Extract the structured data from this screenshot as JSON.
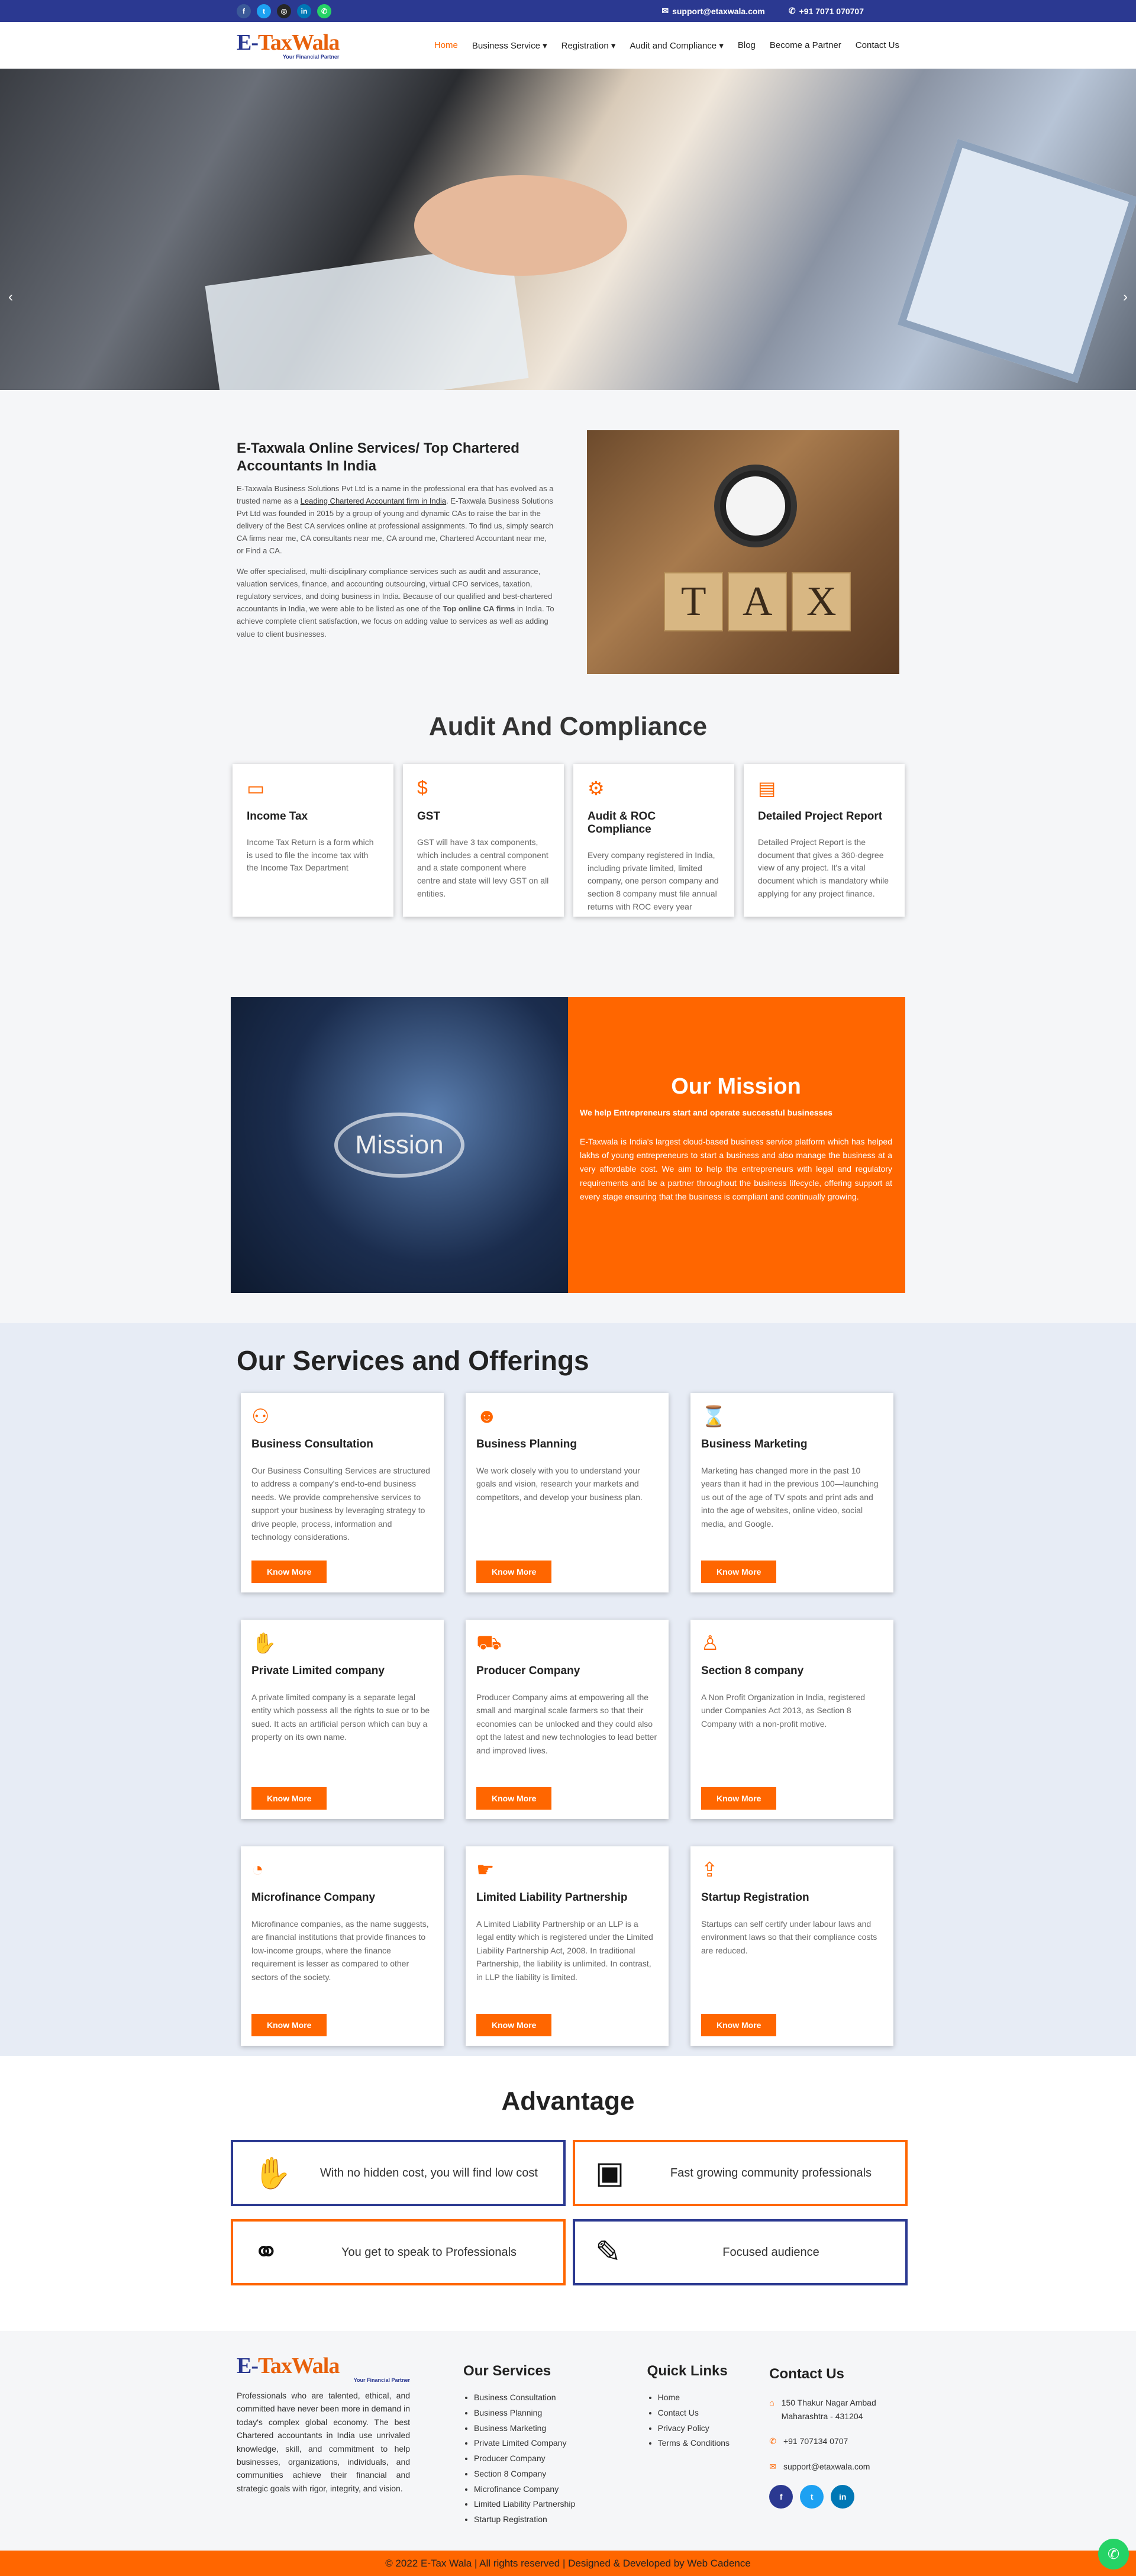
{
  "topbar": {
    "email": "support@etaxwala.com",
    "phone": "+91 7071 070707",
    "socials": [
      "facebook-icon",
      "twitter-icon",
      "instagram-icon",
      "linkedin-icon",
      "whatsapp-icon"
    ]
  },
  "logo": {
    "main_a": "E-",
    "main_b": "TaxWala",
    "sub": "Your Financial Partner"
  },
  "nav": [
    "Home",
    "Business Service",
    "Registration",
    "Audit and Compliance",
    "Blog",
    "Become a Partner",
    "Contact Us"
  ],
  "about": {
    "title": "E-Taxwala Online Services/ Top Chartered Accountants In India",
    "p1a": "E-Taxwala Business Solutions Pvt Ltd is a name in the professional era that has evolved as a trusted name as a ",
    "p1link": "Leading Chartered Accountant firm in India",
    "p1b": ". E-Taxwala Business Solutions Pvt Ltd was founded in 2015 by a group of young and dynamic CAs to raise the bar in the delivery of the Best CA services online at professional assignments. To find us, simply search CA firms near me, CA consultants near me, CA around me, Chartered Accountant near me, or Find a CA.",
    "p2a": "We offer specialised, multi-disciplinary compliance services such as audit and assurance, valuation services, finance, and accounting outsourcing, virtual CFO services, taxation, regulatory services, and doing business in India. Because of our qualified and best-chartered accountants in India, we were able to be listed as one of the ",
    "p2bold": "Top online CA firms",
    "p2b": " in India. To achieve complete client satisfaction, we focus on adding value to services as well as adding value to client businesses.",
    "img_letters": [
      "T",
      "A",
      "X"
    ]
  },
  "audit": {
    "title": "Audit And Compliance",
    "cards": [
      {
        "icon": "money-icon",
        "title": "Income Tax",
        "text": "Income Tax Return is a form which is used to file the income tax with the Income Tax Department"
      },
      {
        "icon": "dollar-icon",
        "title": "GST",
        "text": "GST will have 3 tax components, which includes a central component and a state component where centre and state will levy GST on all entities."
      },
      {
        "icon": "users-gear-icon",
        "title": "Audit & ROC Compliance",
        "text": "Every company registered in India, including private limited, limited company, one person company and section 8 company must file annual returns with ROC every year"
      },
      {
        "icon": "document-icon",
        "title": "Detailed Project Report",
        "text": "Detailed Project Report is the document that gives a 360-degree view of any project. It's a vital document which is mandatory while applying for any project finance."
      }
    ]
  },
  "mission": {
    "img_word": "Mission",
    "title": "Our Mission",
    "subtitle": "We help Entrepreneurs start and operate successful businesses",
    "text": "E-Taxwala is India's largest cloud-based business service platform which has helped lakhs of young entrepreneurs to start a business and also manage the business at a very affordable cost. We aim to help the entrepreneurs with legal and regulatory requirements and be a partner throughout the business lifecycle, offering support at every stage ensuring that the business is compliant and continually growing."
  },
  "services": {
    "title": "Our Services and Offerings",
    "button": "Know More",
    "items": [
      {
        "icon": "handshake-people-icon",
        "title": "Business Consultation",
        "text": "Our Business Consulting Services are structured to address a company's end-to-end business needs. We provide comprehensive services to support your business by leveraging strategy to drive people, process, information and technology considerations."
      },
      {
        "icon": "users-icon",
        "title": "Business Planning",
        "text": "We work closely with you to understand your goals and vision, research your markets and competitors, and develop your business plan."
      },
      {
        "icon": "briefcase-clock-icon",
        "title": "Business Marketing",
        "text": "Marketing has changed more in the past 10 years than it had in the previous 100—launching us out of the age of TV spots and print ads and into the age of websites, online video, social media, and Google."
      },
      {
        "icon": "hands-icon",
        "title": "Private Limited company",
        "text": "A private limited company is a separate legal entity which possess all the rights to sue or to be sued. It acts an artificial person which can buy a property on its own name."
      },
      {
        "icon": "tractor-icon",
        "title": "Producer Company",
        "text": "Producer Company aims at empowering all the small and marginal scale farmers so that their economies can be unlocked and they could also opt the latest and new technologies to lead better and improved lives."
      },
      {
        "icon": "person-icon",
        "title": "Section 8 company",
        "text": "A Non Profit Organization in India, registered under Companies Act 2013, as Section 8 Company with a non-profit motive."
      },
      {
        "icon": "user-clock-icon",
        "title": "Microfinance Company",
        "text": "Microfinance companies, as the name suggests, are financial institutions that provide finances to low-income groups, where the finance requirement is lesser as compared to other sectors of the society."
      },
      {
        "icon": "hand-money-icon",
        "title": "Limited Liability Partnership",
        "text": "A Limited Liability Partnership or an LLP is a legal entity which is registered under the Limited Liability Partnership Act, 2008. In traditional Partnership, the liability is unlimited. In contrast, in LLP the liability is limited."
      },
      {
        "icon": "upload-tray-icon",
        "title": "Startup Registration",
        "text": "Startups can self certify under labour laws and environment laws so that their compliance costs are reduced."
      }
    ]
  },
  "advantage": {
    "title": "Advantage",
    "items": [
      {
        "icon": "hand-coin-icon",
        "text": "With no hidden cost, you will find low cost"
      },
      {
        "icon": "passport-icon",
        "text": "Fast growing community professionals"
      },
      {
        "icon": "handshake-icon",
        "text": "You get to speak to Professionals"
      },
      {
        "icon": "notepad-icon",
        "text": "Focused audience"
      }
    ]
  },
  "footer": {
    "about": "Professionals who are talented, ethical, and committed have never been more in demand in today's complex global economy. The best Chartered accountants in India use unrivaled knowledge, skill, and commitment to help businesses, organizations, individuals, and communities achieve their financial and strategic goals with rigor, integrity, and vision.",
    "services_title": "Our Services",
    "services": [
      "Business Consultation",
      "Business Planning",
      "Business Marketing",
      "Private Limited Company",
      "Producer Company",
      "Section 8 Company",
      "Microfinance Company",
      "Limited Liability Partnership",
      "Startup Registration"
    ],
    "links_title": "Quick Links",
    "links": [
      "Home",
      "Contact Us",
      "Privacy Policy",
      "Terms & Conditions"
    ],
    "contact_title": "Contact Us",
    "address": "150 Thakur Nagar Ambad Maharashtra - 431204",
    "phone": "+91 707134 0707",
    "email": "support@etaxwala.com"
  },
  "copyright": "© 2022 E-Tax Wala | All rights reserved | Designed & Developed by Web Cadence",
  "colors": {
    "brand_blue": "#2b3991",
    "accent_orange": "#ff6600"
  }
}
